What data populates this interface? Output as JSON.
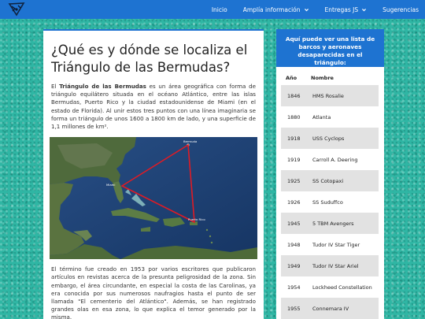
{
  "navbar": {
    "links": [
      {
        "label": "Inicio",
        "dropdown": false
      },
      {
        "label": "Amplía información",
        "dropdown": true
      },
      {
        "label": "Entregas JS",
        "dropdown": true
      },
      {
        "label": "Sugerencias",
        "dropdown": false
      }
    ],
    "color": "#1e73d1"
  },
  "article": {
    "title": "¿Qué es y dónde se localiza el Triángulo de las Bermudas?",
    "intro_prefix": "El ",
    "intro_bold": "Triángulo de las Bermudas",
    "intro_rest": " es un área geográfica con forma de triángulo equilátero situada en el océano Atlántico, entre las islas Bermudas, Puerto Rico y la ciudad estadounidense de Miami (en el estado de Florida). Al unir estos tres puntos con una línea imaginaria se forma un triángulo de unos 1600 a 1800 km de lado, y una superficie de 1,1 millones de km².",
    "map": {
      "labels": {
        "bermuda": "Bermuda",
        "miami": "Miami",
        "puerto_rico": "Puerto Rico"
      },
      "triangle_color": "#e01b24"
    },
    "paragraph2": "El término fue creado en 1953 por varios escritores que publicaron artículos en revistas acerca de la presunta peligrosidad de la zona. Sin embargo, el área circundante, en especial la costa de las Carolinas, ya era conocida por sus numerosos naufragios hasta el punto de ser llamada \"El cementerio del Atlántico\". Además, se han registrado grandes olas en esa zona, lo que explica el temor generado por la misma."
  },
  "sidebar": {
    "heading": "Aquí puede ver una lista de barcos y aeronaves desaparecidas en el triángulo:",
    "columns": [
      "Año",
      "Nombre"
    ],
    "rows": [
      [
        "1846",
        "HMS Rosalie"
      ],
      [
        "1880",
        "Atlanta"
      ],
      [
        "1918",
        "USS Cyclops"
      ],
      [
        "1919",
        "Carroll A. Deering"
      ],
      [
        "1925",
        "SS Cotopaxi"
      ],
      [
        "1926",
        "SS Suduffco"
      ],
      [
        "1945",
        "5 TBM Avengers"
      ],
      [
        "1948",
        "Tudor IV Star Tiger"
      ],
      [
        "1949",
        "Tudor IV Star Ariel"
      ],
      [
        "1954",
        "Lockheed Constellation"
      ],
      [
        "1955",
        "Connemara IV"
      ]
    ]
  }
}
